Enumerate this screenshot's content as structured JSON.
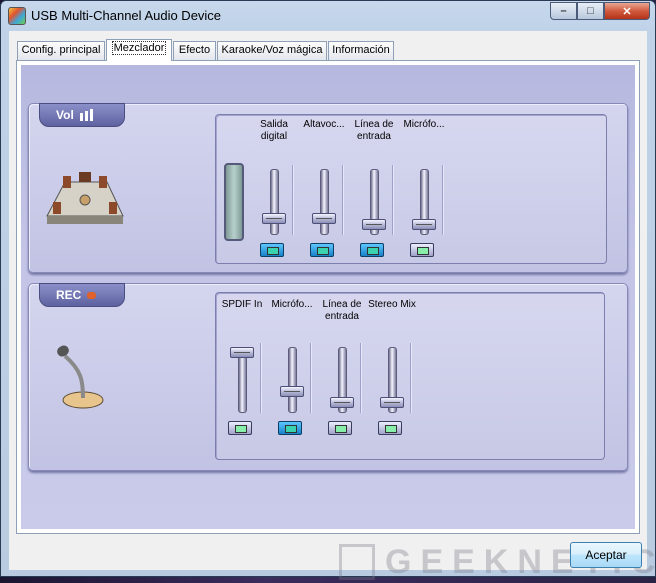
{
  "window": {
    "title": "USB Multi-Channel Audio Device",
    "minimize": "–",
    "maximize": "□",
    "close": "✕"
  },
  "tabs": [
    {
      "label": "Config. principal",
      "active": false
    },
    {
      "label": "Mezclador",
      "active": true
    },
    {
      "label": "Efecto",
      "active": false
    },
    {
      "label": "Karaoke/Voz mágica",
      "active": false
    },
    {
      "label": "Información",
      "active": false
    }
  ],
  "playback": {
    "label": "Vol",
    "icon": "speaker-room-icon",
    "channels": [
      {
        "name": "Salida digital",
        "level": 0.22,
        "mute_active": true
      },
      {
        "name": "Altavoc...",
        "level": 0.22,
        "mute_active": true
      },
      {
        "name": "Línea de entrada",
        "level": 0.1,
        "mute_active": true
      },
      {
        "name": "Micrófo...",
        "level": 0.1,
        "mute_active": false
      }
    ]
  },
  "record": {
    "label": "REC",
    "icon": "microphone-icon",
    "channels": [
      {
        "name": "SPDIF In",
        "level": 1.0,
        "mute_active": false
      },
      {
        "name": "Micrófo...",
        "level": 0.3,
        "mute_active": true
      },
      {
        "name": "Línea de entrada",
        "level": 0.1,
        "mute_active": false
      },
      {
        "name": "Stereo Mix",
        "level": 0.1,
        "mute_active": false
      }
    ]
  },
  "buttons": {
    "ok": "Aceptar"
  },
  "watermark": "GEEKNETIC",
  "colors": {
    "skin": "#c3c4e6",
    "accent": "#5e62a0",
    "mute_on": "#1782c8"
  }
}
